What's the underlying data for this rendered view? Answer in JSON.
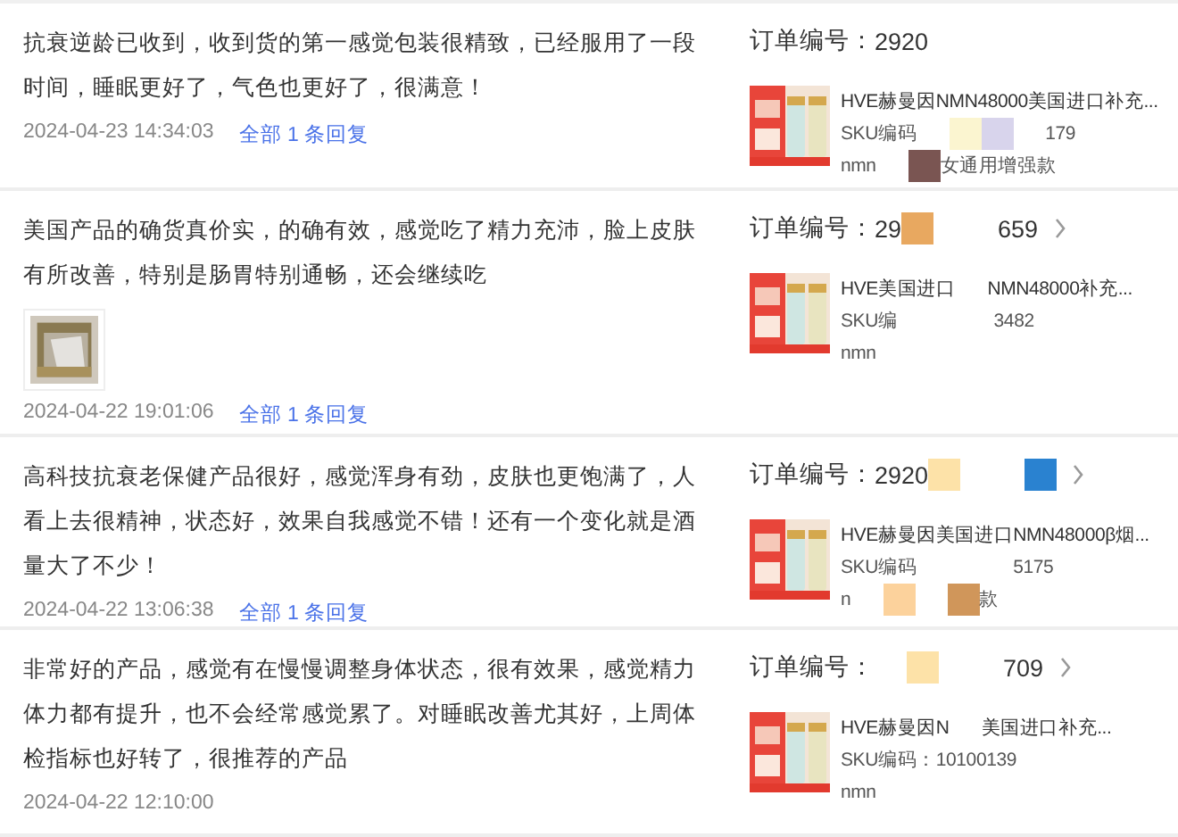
{
  "reviews": [
    {
      "text": "抗衰逆龄已收到，收到货的第一感觉包装很精致，已经服用了一段时间，睡眠更好了，气色也更好了，很满意！",
      "date": "2024-04-23 14:34:03",
      "reply_link": "全部 1 条回复",
      "order": {
        "label": "订单编号：",
        "number": [
          {
            "kind": "text",
            "text": "2920"
          }
        ],
        "arrow": false,
        "title": [
          {
            "kind": "text",
            "text": "HVE赫曼因NMN48000美国进口补充..."
          }
        ],
        "sku": [
          {
            "kind": "text",
            "text": "SKU编码"
          },
          {
            "kind": "gap"
          },
          {
            "kind": "mask",
            "color": "#fbf5d0"
          },
          {
            "kind": "mask",
            "color": "#d8d4ec"
          },
          {
            "kind": "gap"
          },
          {
            "kind": "text",
            "text": "179"
          }
        ],
        "variant": [
          {
            "kind": "text",
            "text": "nmn"
          },
          {
            "kind": "gap"
          },
          {
            "kind": "mask",
            "color": "#7a5552"
          },
          {
            "kind": "text",
            "text": "女通用增强款"
          }
        ]
      }
    },
    {
      "text": "美国产品的确货真价实，的确有效，感觉吃了精力充沛，脸上皮肤有所改善，特别是肠胃特别通畅，还会继续吃",
      "date": "2024-04-22 19:01:06",
      "reply_link": "全部 1 条回复",
      "order": {
        "label": "订单编号：",
        "number": [
          {
            "kind": "text",
            "text": "29"
          },
          {
            "kind": "mask",
            "color": "#e8a860"
          },
          {
            "kind": "gap"
          },
          {
            "kind": "gap"
          },
          {
            "kind": "text",
            "text": "659"
          }
        ],
        "arrow": true,
        "title": [
          {
            "kind": "text",
            "text": "HVE美国进口"
          },
          {
            "kind": "gap"
          },
          {
            "kind": "text",
            "text": "NMN48000补充..."
          }
        ],
        "sku": [
          {
            "kind": "text",
            "text": "SKU编"
          },
          {
            "kind": "gap"
          },
          {
            "kind": "gap"
          },
          {
            "kind": "gap"
          },
          {
            "kind": "text",
            "text": "3482"
          }
        ],
        "variant": [
          {
            "kind": "text",
            "text": "nmn"
          }
        ]
      }
    },
    {
      "text": "高科技抗衰老保健产品很好，感觉浑身有劲，皮肤也更饱满了，人看上去很精神，状态好，效果自我感觉不错！还有一个变化就是酒量大了不少！",
      "date": "2024-04-22 13:06:38",
      "reply_link": "全部 1 条回复",
      "order": {
        "label": "订单编号：",
        "number": [
          {
            "kind": "text",
            "text": "2920"
          },
          {
            "kind": "mask",
            "color": "#fde2a8"
          },
          {
            "kind": "gap"
          },
          {
            "kind": "gap"
          },
          {
            "kind": "mask",
            "color": "#2a82d0"
          }
        ],
        "arrow": true,
        "title": [
          {
            "kind": "text",
            "text": "HVE赫曼因美国进口NMN48000β烟..."
          }
        ],
        "sku": [
          {
            "kind": "text",
            "text": "SKU编码"
          },
          {
            "kind": "gap"
          },
          {
            "kind": "gap"
          },
          {
            "kind": "gap"
          },
          {
            "kind": "text",
            "text": "5175"
          }
        ],
        "variant": [
          {
            "kind": "text",
            "text": "n"
          },
          {
            "kind": "gap"
          },
          {
            "kind": "mask",
            "color": "#fcd29c"
          },
          {
            "kind": "gap"
          },
          {
            "kind": "mask",
            "color": "#d0965a"
          },
          {
            "kind": "text",
            "text": "款"
          }
        ]
      }
    },
    {
      "text": "非常好的产品，感觉有在慢慢调整身体状态，很有效果，感觉精力体力都有提升，也不会经常感觉累了。对睡眠改善尤其好，上周体检指标也好转了，很推荐的产品",
      "date": "2024-04-22 12:10:00",
      "order": {
        "label": "订单编号：",
        "number": [
          {
            "kind": "gap"
          },
          {
            "kind": "mask",
            "color": "#fde2a8"
          },
          {
            "kind": "gap"
          },
          {
            "kind": "gap"
          },
          {
            "kind": "text",
            "text": "709"
          }
        ],
        "arrow": true,
        "title": [
          {
            "kind": "text",
            "text": "HVE赫曼因N"
          },
          {
            "kind": "gap"
          },
          {
            "kind": "text",
            "text": "美国进口补充..."
          }
        ],
        "sku": [
          {
            "kind": "text",
            "text": "SKU编码：10100139"
          }
        ],
        "variant": [
          {
            "kind": "text",
            "text": "nmn"
          }
        ]
      }
    }
  ]
}
